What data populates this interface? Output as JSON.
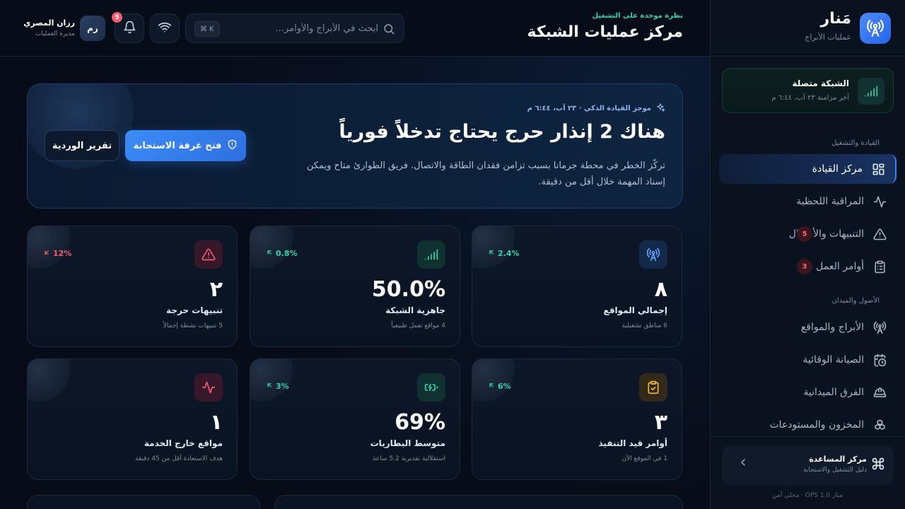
{
  "brand": {
    "name": "مَنار",
    "subtitle": "عمليات الأبراج"
  },
  "network_status": {
    "title": "الشبكة متصلة",
    "subtitle": "آخر مزامنة ٢٣ آب، ٦:٤٤ م"
  },
  "sidebar": {
    "sections": [
      {
        "label": "القيادة والتشغيل"
      },
      {
        "label": "الأصول والميدان"
      }
    ],
    "items": [
      {
        "label": "مركز القيادة",
        "icon": "dashboard-icon"
      },
      {
        "label": "المراقبة اللحظية",
        "icon": "activity-icon"
      },
      {
        "label": "التنبيهات والأعطال",
        "icon": "warning-icon",
        "badge": "5"
      },
      {
        "label": "أوامر العمل",
        "icon": "clipboard-icon",
        "badge": "3"
      },
      {
        "label": "الأبراج والمواقع",
        "icon": "tower-icon"
      },
      {
        "label": "الصيانة الوقائية",
        "icon": "calendar-clock-icon"
      },
      {
        "label": "الفرق الميدانية",
        "icon": "hardhat-icon"
      },
      {
        "label": "المخزون والمستودعات",
        "icon": "boxes-icon"
      }
    ],
    "help": {
      "title": "مركز المساعدة",
      "subtitle": "دليل التشغيل والاستجابة"
    },
    "version": "منار OPS 1.0 · محلي آمن"
  },
  "header": {
    "kicker": "نظرة موحدة على التشغيل",
    "title": "مركز عمليات الشبكة",
    "search_placeholder": "ابحث في الأبراج والأوامر...",
    "shortcut": "⌘ K",
    "notification_count": "5",
    "user": {
      "initials": "رم",
      "name": "رزان المصري",
      "role": "مديرة العمليات"
    }
  },
  "hero": {
    "kicker": "موجز القيادة الذكي · ٢٣ آب، ٦:٤٤ م",
    "title": "هناك 2 إنذار حرج يحتاج تدخلاً فورياً",
    "description": "تركّز الخطر في محطة جرمانا بسبب تزامن فقدان الطاقة والاتصال. فريق الطوارئ متاح ويمكن إسناد المهمة خلال أقل من دقيقة.",
    "primary_button": "فتح غرفة الاستجابة",
    "secondary_button": "تقرير الوردية"
  },
  "stats": [
    {
      "value": "٨",
      "label": "إجمالي المواقع",
      "sub": "6 مناطق تشغيلية",
      "trend": "2.4%",
      "trend_dir": "up",
      "icon": "tower-icon",
      "color": "#60a5fa"
    },
    {
      "value": "50.0%",
      "label": "جاهزية الشبكة",
      "sub": "4 مواقع تعمل طبيعياً",
      "trend": "0.8%",
      "trend_dir": "up",
      "icon": "signal-icon",
      "color": "#2dd4a7"
    },
    {
      "value": "٢",
      "label": "تنبيهات حرجة",
      "sub": "5 تنبيهات نشطة إجمالاً",
      "trend": "12%",
      "trend_dir": "down",
      "icon": "warning-icon",
      "color": "#f25c6b"
    },
    {
      "value": "٣",
      "label": "أوامر قيد التنفيذ",
      "sub": "1 في الموقع الآن",
      "trend": "6%",
      "trend_dir": "up",
      "icon": "clipboard-check-icon",
      "color": "#f5b93a"
    },
    {
      "value": "69%",
      "label": "متوسط البطاريات",
      "sub": "استقلالية تقديرية 5.2 ساعة",
      "trend": "3%",
      "trend_dir": "up",
      "icon": "battery-charging-icon",
      "color": "#2dd4a7"
    },
    {
      "value": "١",
      "label": "مواقع خارج الخدمة",
      "sub": "هدف الاستعادة أقل من 45 دقيقة",
      "trend": "",
      "trend_dir": "",
      "icon": "pulse-icon",
      "color": "#f25c6b"
    }
  ],
  "colors": {
    "accent": "#3b82f6",
    "success": "#2dd4a7",
    "danger": "#f25c6b",
    "warning": "#f5b93a",
    "background": "#060b16"
  }
}
